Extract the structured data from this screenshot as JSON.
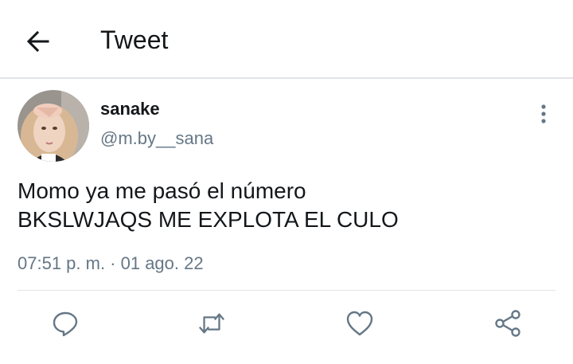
{
  "header": {
    "title": "Tweet",
    "back_icon": "arrow-left-icon"
  },
  "tweet": {
    "author": {
      "display_name": "sanake",
      "handle": "@m.by__sana"
    },
    "text_lines": [
      "Momo ya me pasó el número",
      "BKSLWJAQS ME EXPLOTA EL CULO"
    ],
    "timestamp": "07:51 p. m. · 01 ago. 22",
    "more_icon": "more-vertical-icon"
  },
  "actions": [
    {
      "name": "reply",
      "icon": "reply-icon"
    },
    {
      "name": "retweet",
      "icon": "retweet-icon"
    },
    {
      "name": "like",
      "icon": "heart-icon"
    },
    {
      "name": "share",
      "icon": "share-icon"
    }
  ],
  "colors": {
    "text_primary": "#14171a",
    "text_secondary": "#657786",
    "icon": "#657786",
    "divider": "#e1e4e8"
  }
}
